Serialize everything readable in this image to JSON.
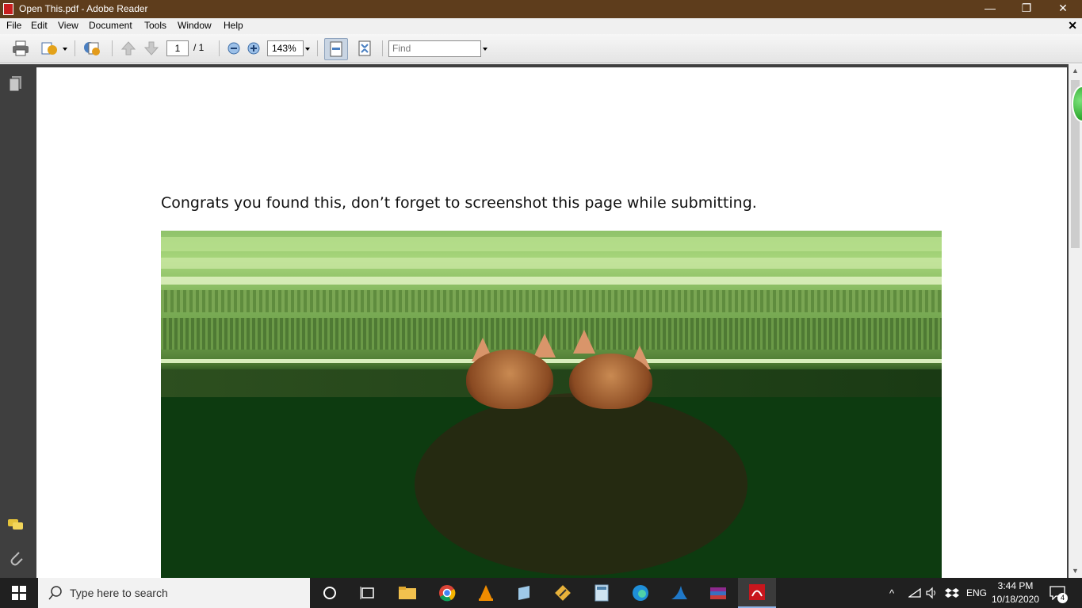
{
  "window": {
    "title": "Open This.pdf - Adobe Reader",
    "minimize_glyph": "—",
    "restore_glyph": "❐",
    "close_glyph": "✕"
  },
  "menubar": {
    "items": [
      "File",
      "Edit",
      "View",
      "Document",
      "Tools",
      "Window",
      "Help"
    ],
    "close_glyph": "✕"
  },
  "toolbar": {
    "page_number": "1",
    "page_total": "/ 1",
    "zoom": "143%",
    "find_placeholder": "Find"
  },
  "document": {
    "text": "Congrats you found this, don’t forget to screenshot this page while submitting."
  },
  "scrollbar": {
    "up_glyph": "▲",
    "down_glyph": "▼"
  },
  "taskbar": {
    "search_placeholder": "Type here to search",
    "language": "ENG",
    "time": "3:44 PM",
    "date": "10/18/2020",
    "notification_count": "4"
  },
  "icons": {
    "navpanel": [
      "pages-icon",
      "comments-icon",
      "attachments-icon"
    ],
    "taskbar_apps": [
      "cortana-icon",
      "task-view-icon",
      "file-explorer-icon",
      "chrome-icon",
      "vlc-icon",
      "notepad-icon",
      "sticky-app-icon",
      "calculator-icon",
      "edge-icon",
      "wireshark-icon",
      "winrar-icon",
      "adobe-reader-icon"
    ]
  },
  "colors": {
    "titlebar": "#5e3d1c",
    "taskbar": "#202020",
    "document_bg": "#3f3f3f"
  }
}
